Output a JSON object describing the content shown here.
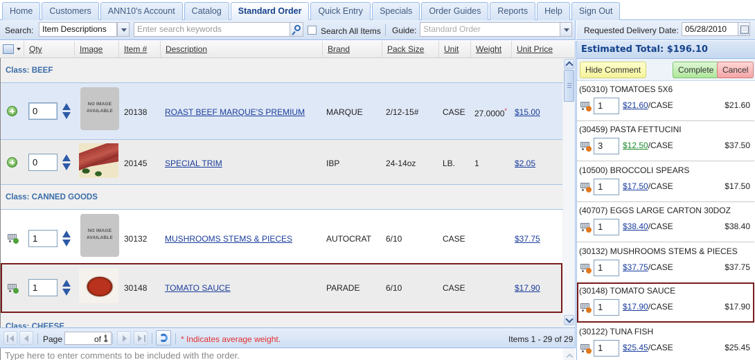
{
  "tabs": [
    {
      "label": "Home",
      "active": false
    },
    {
      "label": "Customers",
      "active": false
    },
    {
      "label": "ANN10's Account",
      "active": false
    },
    {
      "label": "Catalog",
      "active": false
    },
    {
      "label": "Standard Order",
      "active": true
    },
    {
      "label": "Quick Entry",
      "active": false
    },
    {
      "label": "Specials",
      "active": false
    },
    {
      "label": "Order Guides",
      "active": false
    },
    {
      "label": "Reports",
      "active": false
    },
    {
      "label": "Help",
      "active": false
    },
    {
      "label": "Sign Out",
      "active": false
    }
  ],
  "search": {
    "label": "Search:",
    "scope_value": "Item Descriptions",
    "keywords_placeholder": "Enter search keywords",
    "search_all_label": "Search All Items",
    "search_all_checked": false,
    "guide_label": "Guide:",
    "guide_value": "Standard Order"
  },
  "delivery": {
    "label": "Requested Delivery Date:",
    "date": "05/28/2010"
  },
  "grid": {
    "columns": [
      "Qty",
      "Image",
      "Item #",
      "Description",
      "Brand",
      "Pack Size",
      "Unit",
      "Weight",
      "Unit Price"
    ],
    "classes": [
      {
        "label": "Class: BEEF"
      },
      {
        "label": "Class: CANNED GOODS"
      },
      {
        "label": "Class: CHEESE"
      }
    ],
    "no_image_text_1": "NO IMAGE",
    "no_image_text_2": "AVAILABLE",
    "rows": [
      {
        "class": "BEEF",
        "action_icon": "add-circle-icon",
        "qty": "0",
        "image": "no-image",
        "item": "20138",
        "description": "ROAST BEEF MARQUE'S PREMIUM",
        "brand": "MARQUE",
        "pack": "2/12-15#",
        "unit": "CASE",
        "weight": "27.0000",
        "avg_weight": true,
        "price": "$15.00"
      },
      {
        "class": "BEEF",
        "action_icon": "add-circle-icon",
        "qty": "0",
        "image": "beef-photo",
        "item": "20145",
        "description": "SPECIAL TRIM",
        "brand": "IBP",
        "pack": "24-14oz",
        "unit": "LB.",
        "weight": "1",
        "avg_weight": false,
        "price": "$2.05"
      },
      {
        "class": "CANNED GOODS",
        "action_icon": "cart-add-icon",
        "qty": "1",
        "image": "no-image",
        "item": "30132",
        "description": "MUSHROOMS STEMS & PIECES",
        "brand": "AUTOCRAT",
        "pack": "6/10",
        "unit": "CASE",
        "weight": "",
        "avg_weight": false,
        "price": "$37.75"
      },
      {
        "class": "CANNED GOODS",
        "action_icon": "cart-add-icon",
        "qty": "1",
        "image": "tomato-sauce-photo",
        "item": "30148",
        "description": "TOMATO SAUCE",
        "brand": "PARADE",
        "pack": "6/10",
        "unit": "CASE",
        "weight": "",
        "avg_weight": false,
        "price": "$17.90"
      }
    ]
  },
  "paging": {
    "page_label": "Page",
    "page_value": "1",
    "of_label": "of 1",
    "note": "* Indicates average weight.",
    "summary": "Items 1 - 29 of 29"
  },
  "comment": {
    "placeholder": "Type here to enter comments to be included with the order."
  },
  "order": {
    "estimated_total": "Estimated Total: $196.10",
    "hide_comment": "Hide Comment",
    "complete": "Complete",
    "cancel": "Cancel",
    "items": [
      {
        "name": "(50310) TOMATOES 5X6",
        "qty": "1",
        "price": "$21.60",
        "per": "/CASE",
        "total": "$21.60",
        "special": false
      },
      {
        "name": "(30459) PASTA FETTUCINI",
        "qty": "3",
        "price": "$12.50",
        "per": "/CASE",
        "total": "$37.50",
        "special": true
      },
      {
        "name": "(10500) BROCCOLI SPEARS",
        "qty": "1",
        "price": "$17.50",
        "per": "/CASE",
        "total": "$17.50",
        "special": false
      },
      {
        "name": "(40707) EGGS LARGE CARTON 30DOZ",
        "qty": "1",
        "price": "$38.40",
        "per": "/CASE",
        "total": "$38.40",
        "special": false
      },
      {
        "name": "(30132) MUSHROOMS STEMS & PIECES",
        "qty": "1",
        "price": "$37.75",
        "per": "/CASE",
        "total": "$37.75",
        "special": false
      },
      {
        "name": "(30148) TOMATO SAUCE",
        "qty": "1",
        "price": "$17.90",
        "per": "/CASE",
        "total": "$17.90",
        "special": false
      },
      {
        "name": "(30122) TUNA FISH",
        "qty": "1",
        "price": "$25.45",
        "per": "/CASE",
        "total": "$25.45",
        "special": false
      }
    ]
  },
  "colors": {
    "tab_text": "#3f5a80",
    "active_tab_text": "#15428b",
    "class_header": "#3a6ca8",
    "link": "#1a3d9c",
    "special_price": "#1d8a2a",
    "focus_outline": "#7a1a1a",
    "avg_weight_note": "#e23030"
  }
}
